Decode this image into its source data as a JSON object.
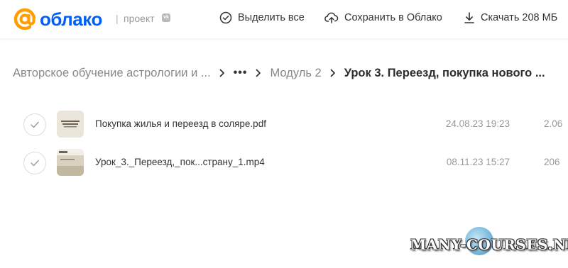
{
  "header": {
    "logo_text": "облако",
    "separator": "|",
    "project_label": "проект",
    "vk_badge": "vk",
    "actions": {
      "select_all": "Выделить все",
      "save_to_cloud": "Сохранить в Облако",
      "download": "Скачать 208 МБ"
    }
  },
  "breadcrumb": {
    "root": "Авторское обучение астрологии и ...",
    "ellipsis": "•••",
    "module": "Модуль 2",
    "current": "Урок 3. Переезд, покупка нового ..."
  },
  "files": [
    {
      "name": "Покупка жилья и переезд в соляре.pdf",
      "date": "24.08.23 19:23",
      "size": "2.06"
    },
    {
      "name": "Урок_3._Переезд,_пок...страну_1.mp4",
      "date": "08.11.23 15:27",
      "size": "206"
    }
  ],
  "watermark": "MANY-COURSES.NET",
  "colors": {
    "brand_blue": "#005ff9",
    "brand_orange": "#ff9e00"
  }
}
